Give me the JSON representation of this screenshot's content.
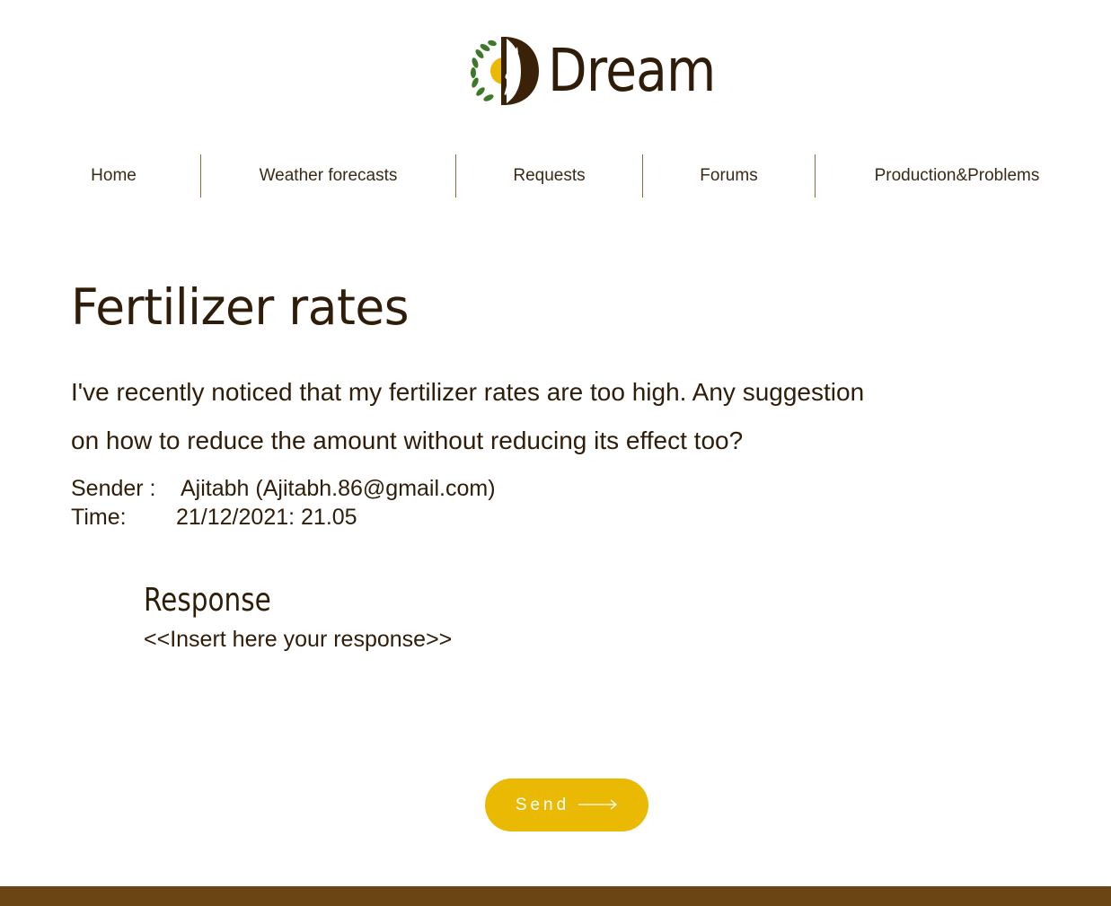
{
  "brand": {
    "name": "Dream",
    "logo_icon": "wheat-sun-laurel-logo"
  },
  "nav": {
    "items": [
      {
        "label": "Home"
      },
      {
        "label": "Weather forecasts"
      },
      {
        "label": "Requests"
      },
      {
        "label": "Forums"
      },
      {
        "label": "Production&Problems"
      }
    ]
  },
  "request": {
    "title": "Fertilizer rates",
    "message_line1": "I've recently noticed that my fertilizer rates are too high. Any suggestion",
    "message_line2": "on how to reduce the amount without reducing its effect too?",
    "sender_label": "Sender :",
    "sender_value": "Ajitabh (Ajitabh.86@gmail.com)",
    "time_label": "Time:",
    "time_value": "21/12/2021: 21.05"
  },
  "response": {
    "heading": "Response",
    "placeholder": "<<Insert here your response>>"
  },
  "send_button": {
    "label": "Send",
    "icon": "arrow-right-icon"
  },
  "colors": {
    "text": "#2f1d09",
    "accent_yellow": "#e9b904",
    "footer_brown": "#6b4513",
    "leaf_green": "#3c7a2a"
  }
}
